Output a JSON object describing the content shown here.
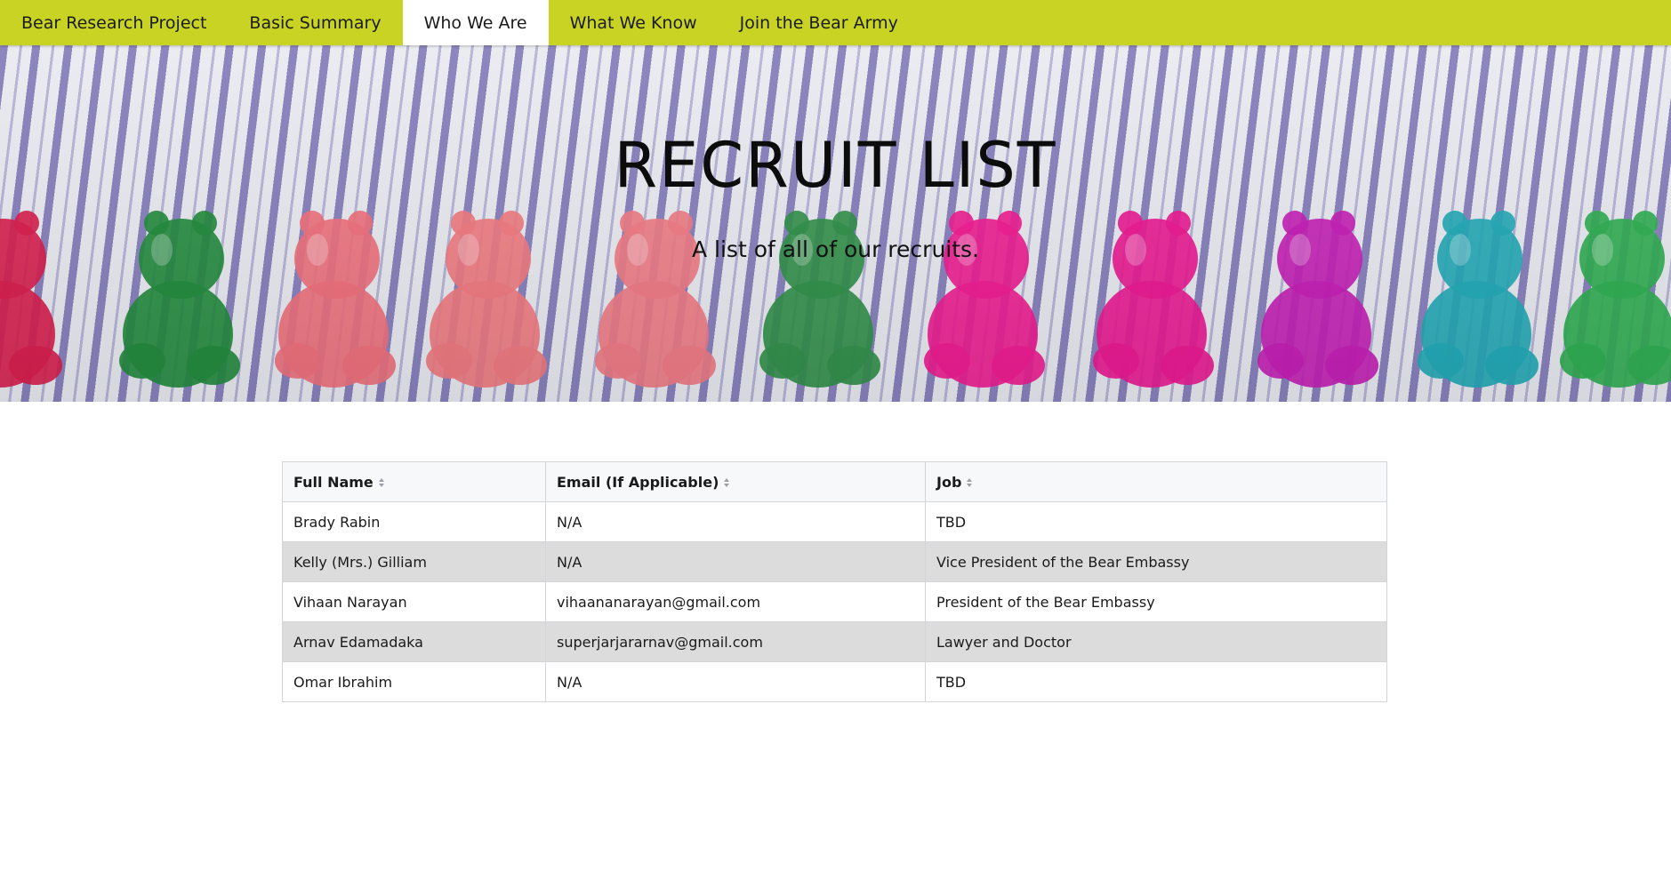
{
  "nav": {
    "items": [
      {
        "label": "Bear Research Project",
        "active": false
      },
      {
        "label": "Basic Summary",
        "active": false
      },
      {
        "label": "Who We Are",
        "active": true
      },
      {
        "label": "What We Know",
        "active": false
      },
      {
        "label": "Join the Bear Army",
        "active": false
      }
    ],
    "color": "#c8d323"
  },
  "hero": {
    "title": "RECRUIT LIST",
    "subtitle": "A list of all of our recruits.",
    "bear_colors": [
      "#d81b4a",
      "#1f8a3a",
      "#ef6f7a",
      "#f0787e",
      "#f07a82",
      "#2f8f46",
      "#f0198f",
      "#ec1690",
      "#c41cb4",
      "#1fa9b5",
      "#2cae4e"
    ]
  },
  "table": {
    "columns": [
      "Full Name",
      "Email (If Applicable)",
      "Job"
    ],
    "rows": [
      [
        "Brady Rabin",
        "N/A",
        "TBD"
      ],
      [
        "Kelly (Mrs.) Gilliam",
        "N/A",
        "Vice President of the Bear Embassy"
      ],
      [
        "Vihaan Narayan",
        "vihaananarayan@gmail.com",
        "President of the Bear Embassy"
      ],
      [
        "Arnav Edamadaka",
        "superjarjararnav@gmail.com",
        "Lawyer and Doctor"
      ],
      [
        "Omar Ibrahim",
        "N/A",
        "TBD"
      ]
    ]
  }
}
